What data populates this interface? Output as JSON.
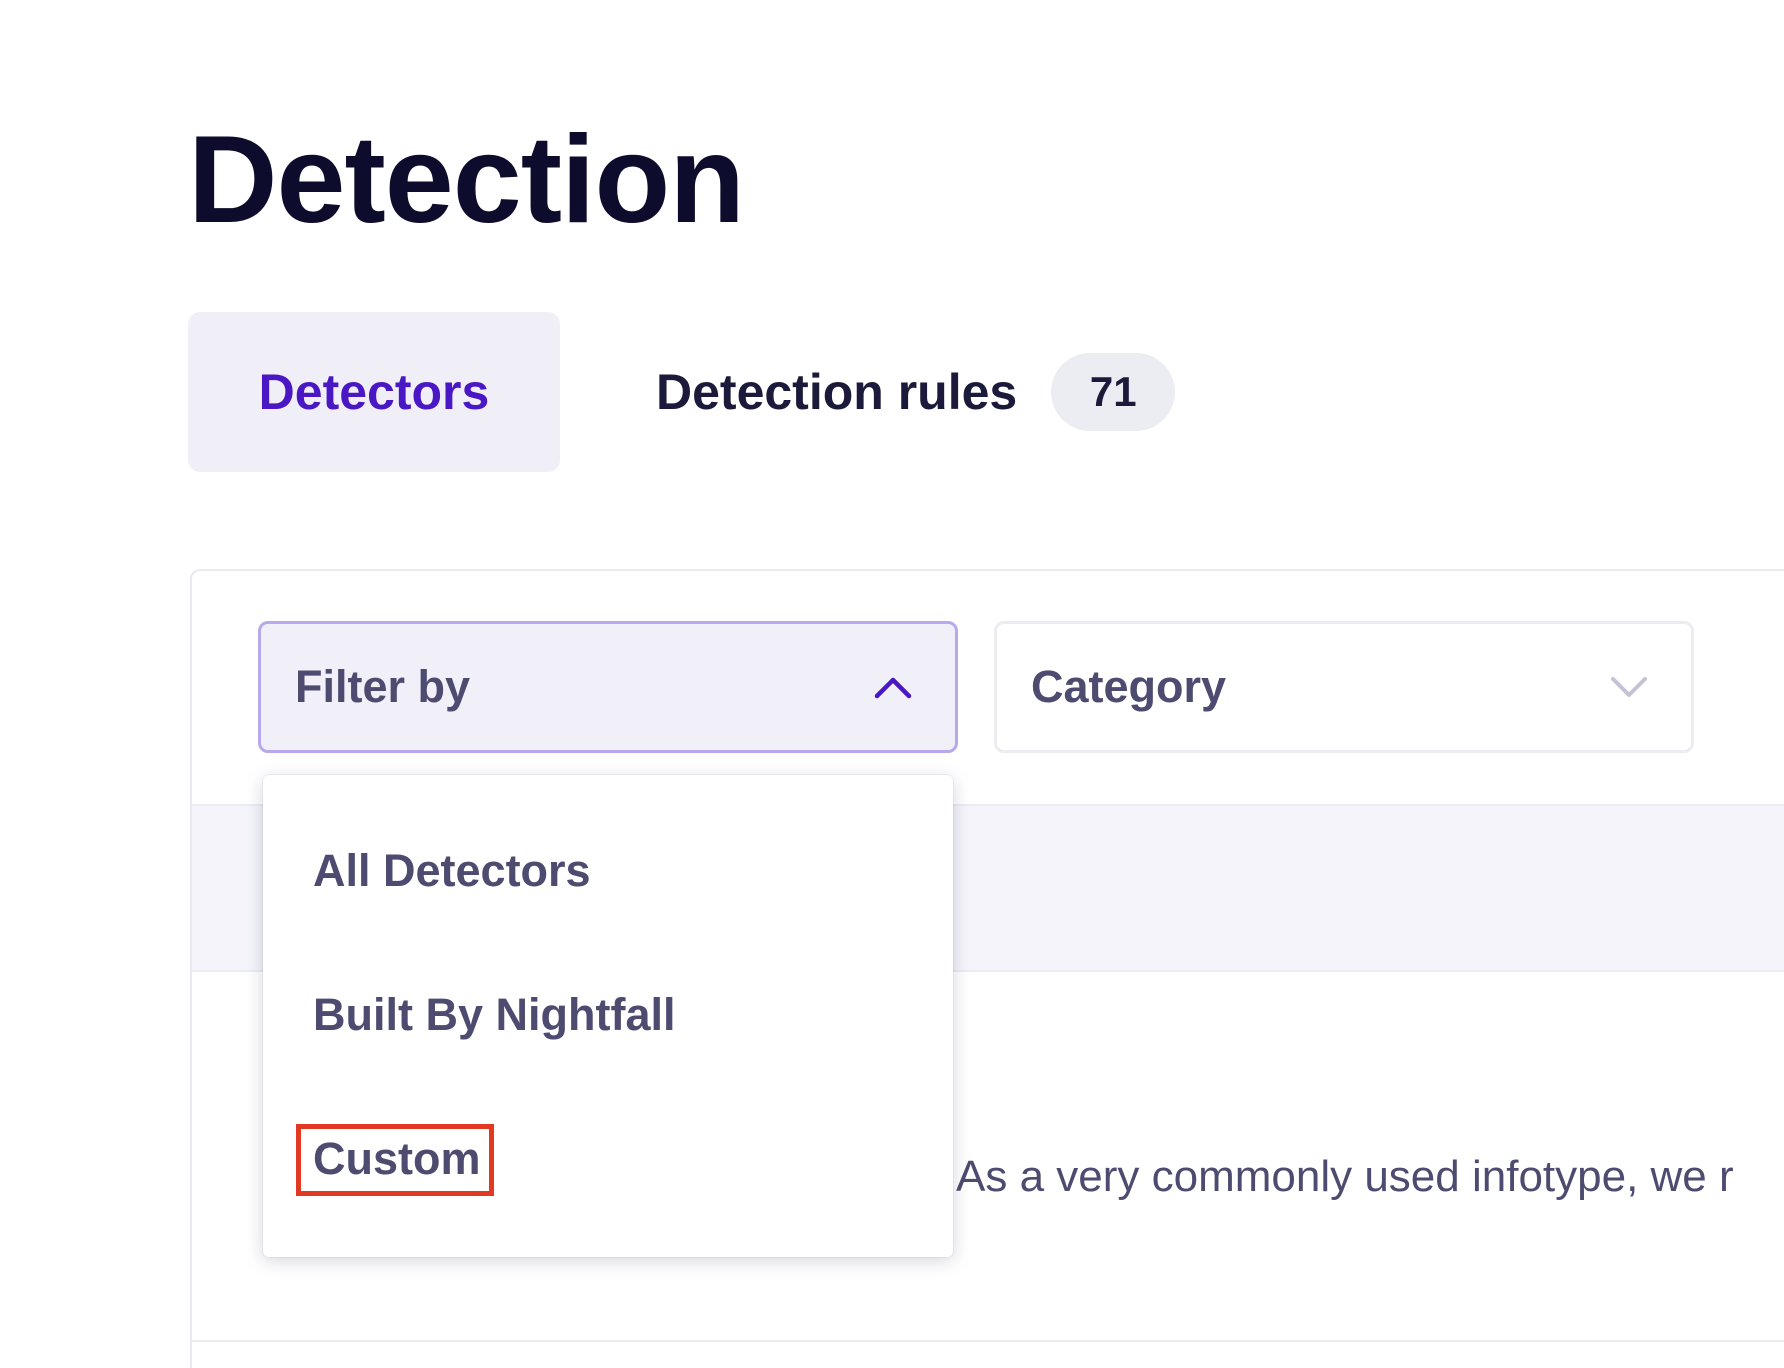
{
  "page": {
    "title": "Detection"
  },
  "tabs": [
    {
      "label": "Detectors",
      "active": true
    },
    {
      "label": "Detection rules",
      "count": "71",
      "active": false
    }
  ],
  "filters": {
    "filter_by": {
      "label": "Filter by",
      "open": true,
      "chevron_icon": "chevron-up-icon",
      "options": [
        "All Detectors",
        "Built By Nightfall",
        "Custom"
      ],
      "highlighted_option": "Custom"
    },
    "category": {
      "label": "Category",
      "chevron_icon": "chevron-down-icon"
    }
  },
  "table": {
    "visible_row_text": "As a very commonly used infotype, we r"
  },
  "colors": {
    "active_tab": "#4a17c4",
    "title": "#0e0c2c",
    "highlight": "#e23a22"
  }
}
